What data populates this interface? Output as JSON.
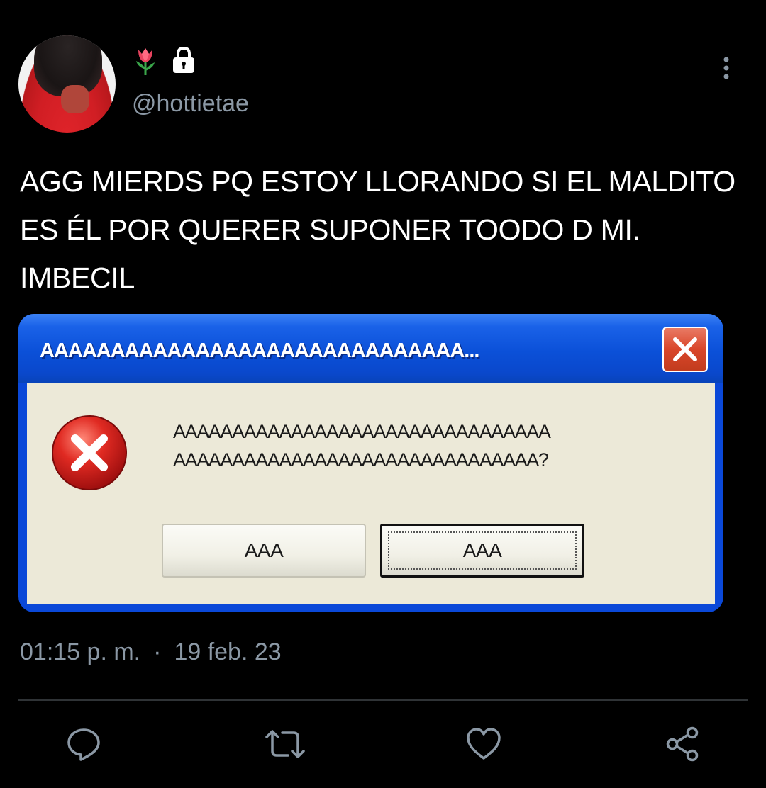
{
  "user": {
    "handle": "@hottietae",
    "name_emojis": [
      "tulip-icon",
      "lock-icon"
    ]
  },
  "tweet": {
    "text_lines": [
      "AGG MIERDS PQ ESTOY LLORANDO SI EL MALDITO",
      "ES ÉL POR QUERER SUPONER TOODO D MI.",
      "IMBECIL"
    ],
    "time": "01:15 p. m.",
    "separator": "·",
    "date": "19 feb. 23"
  },
  "media": {
    "dialog_title": "AAAAAAAAAAAAAAAAAAAAAAAAAAAAAA...",
    "message_lines": [
      "AAAAAAAAAAAAAAAAAAAAAAAAAAAAAAAA",
      "AAAAAAAAAAAAAAAAAAAAAAAAAAAAAAA?"
    ],
    "button_left": "AAA",
    "button_right": "AAA"
  },
  "actions": [
    "reply-icon",
    "retweet-icon",
    "like-icon",
    "share-icon"
  ],
  "colors": {
    "background": "#000000",
    "text": "#ffffff",
    "muted": "#8b98a5",
    "xp_blue": "#0b50d8",
    "xp_body": "#ece9d8",
    "error_red": "#c81818"
  }
}
